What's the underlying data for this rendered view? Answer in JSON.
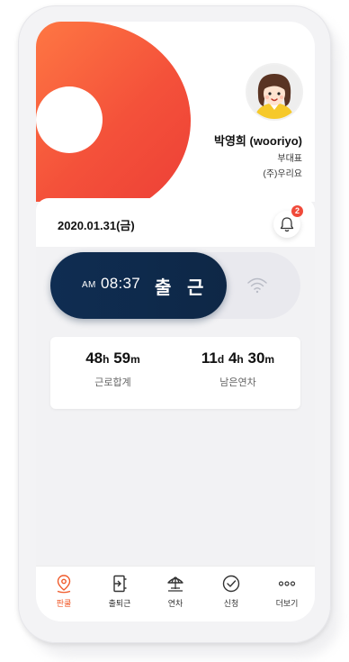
{
  "profile": {
    "name": "박영희 (wooriyo)",
    "title": "부대표",
    "company": "(주)우리요"
  },
  "header": {
    "date": "2020.01.31(금)",
    "notification_count": "2"
  },
  "punch": {
    "ampm": "AM",
    "time": "08:37",
    "action": "출 근"
  },
  "stats": {
    "work_total": {
      "d": "48",
      "u1": "h",
      "d2": " 59",
      "u2": "m",
      "label": "근로합계"
    },
    "remaining_leave": {
      "d": "11",
      "u1": "d",
      "d2": " 4",
      "u2": "h",
      "d3": " 30",
      "u3": "m",
      "label": "남은연차"
    }
  },
  "tabs": [
    {
      "label": "판쿨",
      "icon": "map-pin-icon",
      "active": true
    },
    {
      "label": "출퇴근",
      "icon": "door-icon",
      "active": false
    },
    {
      "label": "연차",
      "icon": "umbrella-icon",
      "active": false
    },
    {
      "label": "신청",
      "icon": "check-circle-icon",
      "active": false
    },
    {
      "label": "더보기",
      "icon": "more-icon",
      "active": false
    }
  ],
  "colors": {
    "accent": "#f05a2a",
    "navy": "#0f2d52",
    "badge": "#f04a3a"
  }
}
